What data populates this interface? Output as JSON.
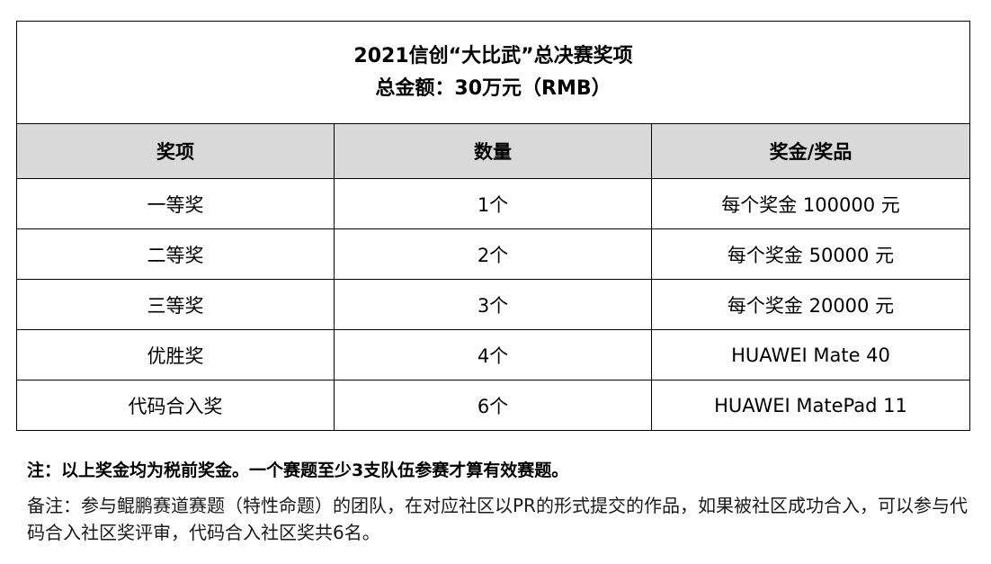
{
  "title": {
    "line1": "2021信创“大比武”总决赛奖项",
    "line2": "总金额：30万元（RMB）"
  },
  "columns": [
    "奖项",
    "数量",
    "奖金/奖品"
  ],
  "rows": [
    {
      "award": "一等奖",
      "quantity": "1个",
      "prize": "每个奖金 100000 元"
    },
    {
      "award": "二等奖",
      "quantity": "2个",
      "prize": "每个奖金 50000 元"
    },
    {
      "award": "三等奖",
      "quantity": "3个",
      "prize": "每个奖金 20000 元"
    },
    {
      "award": "优胜奖",
      "quantity": "4个",
      "prize": "HUAWEI Mate 40"
    },
    {
      "award": "代码合入奖",
      "quantity": "6个",
      "prize": "HUAWEI MatePad 11"
    }
  ],
  "notes": {
    "bold": "注：以上奖金均为税前奖金。一个赛题至少3支队伍参赛才算有效赛题。",
    "normal": "备注：参与鲲鹏赛道赛题（特性命题）的团队，在对应社区以PR的形式提交的作品，如果被社区成功合入，可以参与代码合入社区奖评审，代码合入社区奖共6名。"
  }
}
